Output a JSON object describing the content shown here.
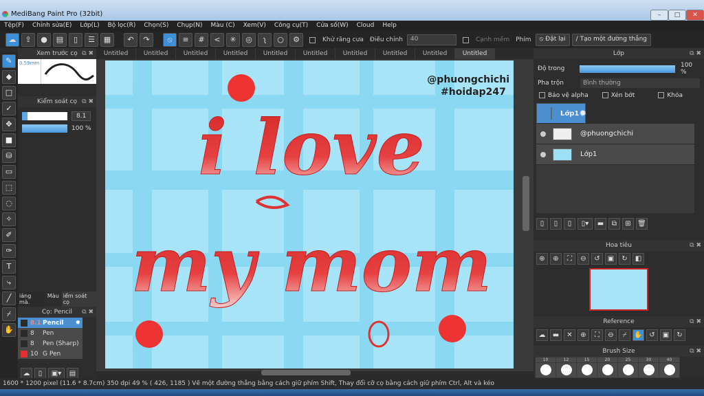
{
  "window": {
    "title": "MediBang Paint Pro (32bit)",
    "minimize": "–",
    "maximize": "□",
    "close": "✕"
  },
  "menu": [
    "Tệp(F)",
    "Chỉnh sửa(E)",
    "Lớp(L)",
    "Bộ lọc(R)",
    "Chọn(S)",
    "Chụp(N)",
    "Màu (C)",
    "Xem(V)",
    "Công cụ(T)",
    "Cửa số(W)",
    "Cloud",
    "Help"
  ],
  "toolbar": {
    "antialias": "Khử răng cưa",
    "adjust_label": "Điều chỉnh",
    "adjust_value": "40",
    "soft_edge": "Cạnh mềm",
    "key_label": "Phím",
    "reset": "Đặt lại",
    "make_line": "Tạo một đường thẳng"
  },
  "tabs": [
    "Untitled",
    "Untitled",
    "Untitled",
    "Untitled",
    "Untitled",
    "Untitled",
    "Untitled",
    "Untitled",
    "Untitled",
    "Untitled"
  ],
  "brush_preview": {
    "title": "Xem trước cọ",
    "size": "0.59mm"
  },
  "brush_control": {
    "title": "Kiểm soát cọ",
    "size": "8.1",
    "opacity": "100 %",
    "size_fraction": 0.12,
    "opacity_fraction": 1.0
  },
  "left_tabs": [
    "iảng mà.",
    "Màu",
    "iểm soát cọ"
  ],
  "brush_list": {
    "title": "Cọ: Pencil",
    "items": [
      {
        "size": "8.1",
        "name": "Pencil",
        "color": "#2b2b2b",
        "selected": true
      },
      {
        "size": "8",
        "name": "Pen",
        "color": "#2b2b2b"
      },
      {
        "size": "8",
        "name": "Pen (Sharp)",
        "color": "#2b2b2b"
      },
      {
        "size": "10",
        "name": "G Pen",
        "color": "#e53030"
      }
    ]
  },
  "artwork": {
    "line1": "i love",
    "line2": "my mom",
    "watermark1": "@phuongchichi",
    "watermark2": "#hoidap247"
  },
  "layers": {
    "title": "Lớp",
    "opacity_label": "Độ trong",
    "opacity_value": "100 %",
    "blend_label": "Pha trộn",
    "blend_value": "Bình thường",
    "protect_alpha": "Bảo vệ alpha",
    "clipping": "Xén bớt",
    "lock": "Khóa",
    "items": [
      {
        "name": "Lớp1",
        "selected": true
      },
      {
        "name": "@phuongchichi"
      },
      {
        "name": "Lớp1"
      }
    ]
  },
  "navigator": {
    "title": "Hoa tiêu"
  },
  "reference": {
    "title": "Reference"
  },
  "brush_size": {
    "title": "Brush Size",
    "sizes": [
      "10",
      "12",
      "15",
      "20",
      "25",
      "30",
      "40"
    ]
  },
  "status": {
    "dimensions": "1600 * 1200 pixel",
    "physical": "(11.6 * 8.7cm)",
    "dpi": "350 dpi",
    "zoom": "49 %",
    "coords": "( 426, 1185 )",
    "hint": "Vẽ một đường thẳng bằng cách giữ phím Shift, Thay đổi cỡ cọ bằng cách giữ phím Ctrl, Alt và kéo"
  }
}
